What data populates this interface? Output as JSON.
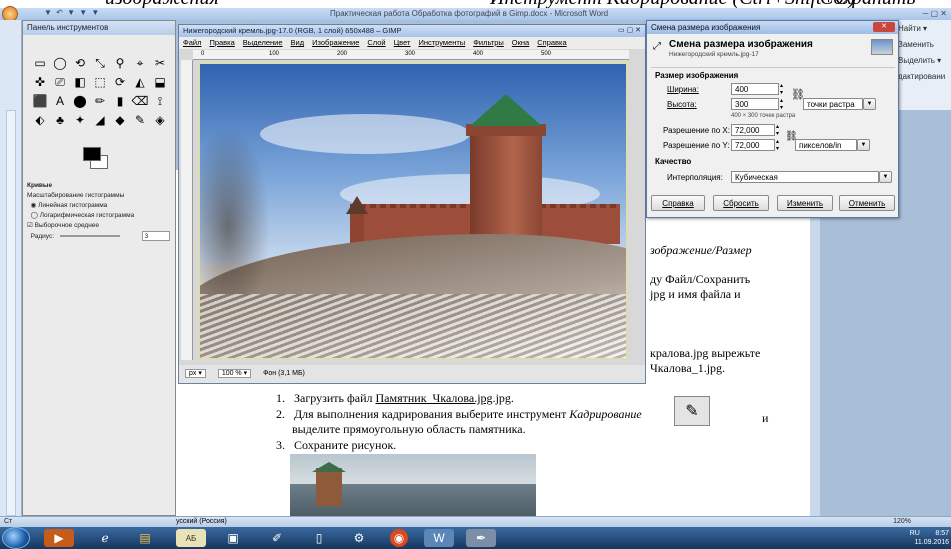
{
  "top_doc_strip": {
    "left": "изображения",
    "mid": "Инструмент Кадрирование (Ctrl+Shift+C)",
    "right": "Сохранить"
  },
  "word": {
    "title": "Практическая работа Обработка фотографий в Gimp.docx - Microsoft Word",
    "quick_access": "▼ ↶ ▼ ▼ ▼",
    "window_controls": "─  ▢  ✕",
    "ribbon_right": [
      "Найти ▾",
      "Заменить",
      "Выделить ▾",
      "дактировани"
    ],
    "doc_lines": {
      "l1_italic": "зображение/Размер",
      "l2": "ду Файл/Сохранить",
      "l3": "jpg и имя файла и",
      "l4": "кралова.jpg вырежьте",
      "l5": "Чкалова_1.jpg."
    },
    "list": [
      {
        "n": "1.",
        "text": "Загрузить файл ",
        "link": "Памятник_Чкалова.jpg",
        "tail": ".jpg."
      },
      {
        "n": "2.",
        "text": "Для выполнения кадрирования выберите инструмент ",
        "italic": "Кадрирование",
        "tail2": "и",
        "line2": "выделите прямоугольную область памятника."
      },
      {
        "n": "3.",
        "text": "Сохраните рисунок."
      }
    ],
    "status_left": "Ст",
    "status_lang": "усский (Россия)",
    "zoom": "120%"
  },
  "gimp_toolbox": {
    "title": "Панель инструментов",
    "tool_icons": [
      "▭",
      "◯",
      "⟲",
      "⤡",
      "⚲",
      "⌖",
      "✂",
      "✜",
      "⎚",
      "◧",
      "⬚",
      "⟳",
      "◭",
      "⬓",
      "⬛",
      "A",
      "⬤",
      "✏",
      "▮",
      "⌫",
      "⟟",
      "⬖",
      "♣",
      "✦",
      "◢",
      "◆",
      "✎",
      "◈"
    ],
    "options": {
      "title": "Кривые",
      "scale_label": "Масштабирование гистограммы",
      "linear": "Линейная гистограмма",
      "log": "Логарифмическая гистограмма",
      "avg": "Выборочное среднее",
      "radius_label": "Радиус:",
      "radius_value": "3"
    }
  },
  "gimp_window": {
    "title": "Нижегородский кремль.jpg-17.0 (RGB, 1 слой) 650x488 – GIMP",
    "menu": [
      "Файл",
      "Правка",
      "Выделение",
      "Вид",
      "Изображение",
      "Слой",
      "Цвет",
      "Инструменты",
      "Фильтры",
      "Окна",
      "Справка"
    ],
    "ruler_ticks": [
      "0",
      "100",
      "200",
      "300",
      "400",
      "500"
    ],
    "unit": "px ▾",
    "zoom": "100 % ▾",
    "status": "Фон (3,1 МБ)"
  },
  "scale_dialog": {
    "title": "Смена размера изображения",
    "heading": "Смена размера изображения",
    "subheading": "Нижегородский кремль.jpg-17",
    "section_size": "Размер изображения",
    "width_label": "Ширина:",
    "width_value": "400",
    "height_label": "Высота:",
    "height_value": "300",
    "units_value": "точки растра",
    "size_note": "400 × 300 точек растра",
    "xres_label": "Разрешение по X:",
    "xres_value": "72,000",
    "yres_label": "Разрешение по Y:",
    "yres_value": "72,000",
    "res_units": "пикселов/in",
    "section_quality": "Качество",
    "interp_label": "Интерполяция:",
    "interp_value": "Кубическая",
    "buttons": {
      "help": "Справка",
      "reset": "Сбросить",
      "scale": "Изменить",
      "cancel": "Отменить"
    },
    "close": "✕"
  },
  "taskbar": {
    "clock": "8:57",
    "date": "11.09.2016",
    "lang": "RU"
  }
}
